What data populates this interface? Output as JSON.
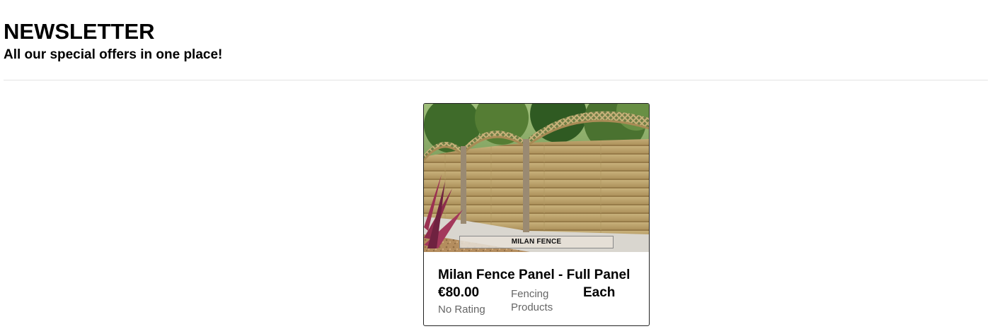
{
  "header": {
    "title": "NEWSLETTER",
    "subtitle": "All our special offers in one place!"
  },
  "products": [
    {
      "image_label": "MILAN FENCE",
      "name": "Milan Fence Panel - Full Panel",
      "price": "€80.00",
      "category": "Fencing Products",
      "unit": "Each",
      "rating": "No Rating"
    }
  ]
}
